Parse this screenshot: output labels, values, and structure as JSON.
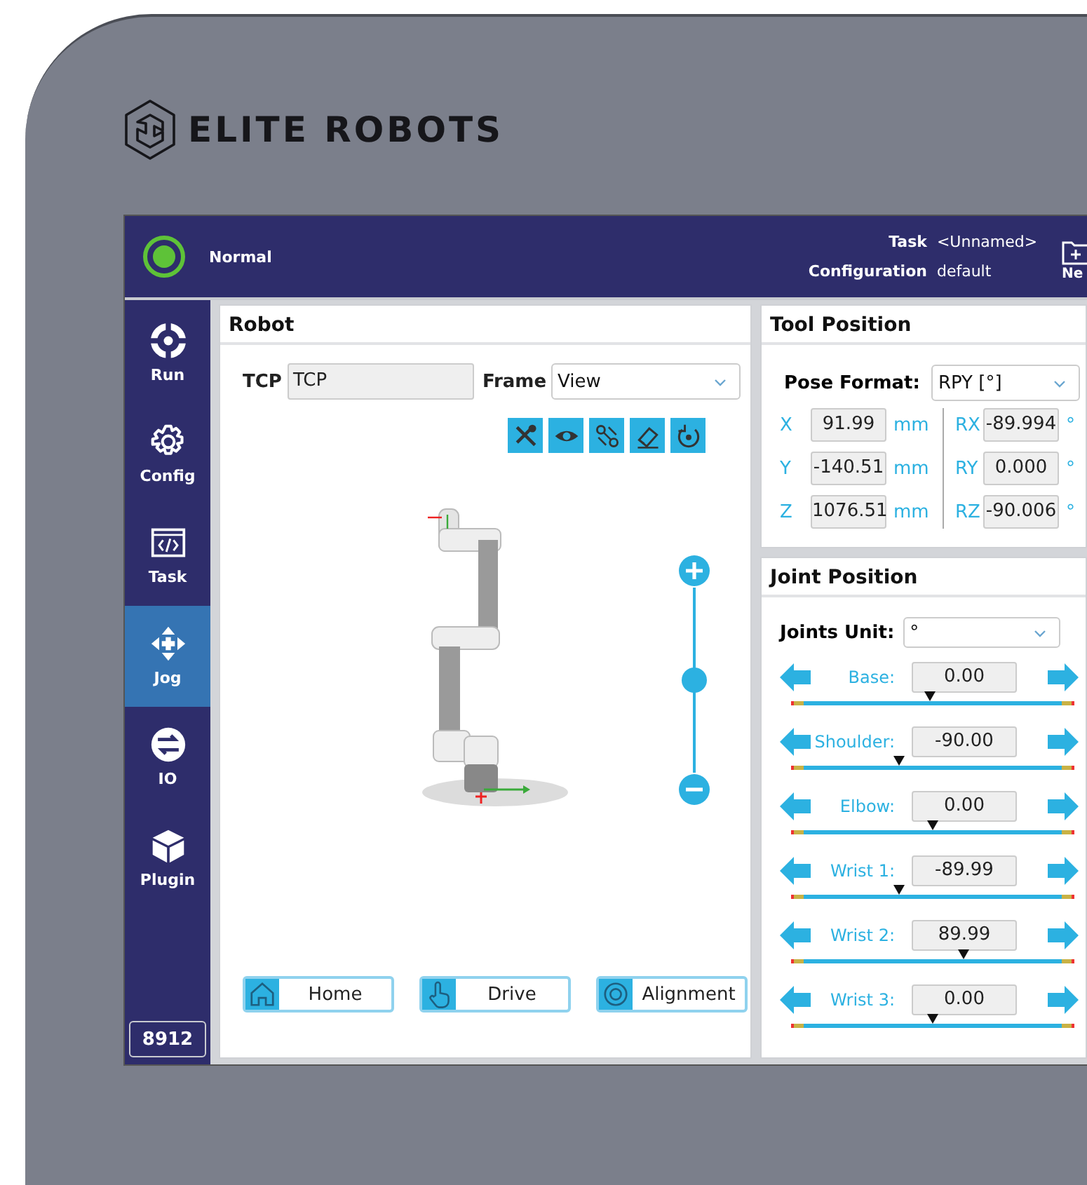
{
  "brand": {
    "name": "ELITE ROBOTS"
  },
  "header": {
    "status": {
      "label": "Normal",
      "color": "#5ec238"
    },
    "task_label": "Task",
    "task_value": "<Unnamed>",
    "configuration_label": "Configuration",
    "configuration_value": "default",
    "new_button": "Ne"
  },
  "sidebar": {
    "items": [
      {
        "label": "Run",
        "kind": "run",
        "selected": false
      },
      {
        "label": "Config",
        "kind": "config",
        "selected": false
      },
      {
        "label": "Task",
        "kind": "task",
        "selected": false
      },
      {
        "label": "Jog",
        "kind": "jog",
        "selected": true
      },
      {
        "label": "IO",
        "kind": "io",
        "selected": false
      },
      {
        "label": "Plugin",
        "kind": "plugin",
        "selected": false
      }
    ],
    "badge": "8912"
  },
  "robot_panel": {
    "title": "Robot",
    "tcp_label": "TCP",
    "tcp_value": "TCP",
    "frame_label": "Frame",
    "frame_value": "View",
    "tools": [
      {
        "kind": "tools"
      },
      {
        "kind": "eye"
      },
      {
        "kind": "path"
      },
      {
        "kind": "eraser"
      },
      {
        "kind": "rotate"
      }
    ],
    "zoom": {
      "level": 0.5
    },
    "buttons": [
      {
        "label": "Home",
        "kind": "home"
      },
      {
        "label": "Drive",
        "kind": "hand"
      },
      {
        "label": "Alignment",
        "kind": "target"
      }
    ]
  },
  "tool_position": {
    "title": "Tool Position",
    "format_label": "Pose Format:",
    "format_value": "RPY [°]",
    "rows": [
      {
        "axis": "X",
        "value": "91.99",
        "unit": "mm",
        "rot_axis": "RX",
        "rot_value": "-89.994",
        "rot_unit": "°"
      },
      {
        "axis": "Y",
        "value": "-140.51",
        "unit": "mm",
        "rot_axis": "RY",
        "rot_value": "0.000",
        "rot_unit": "°"
      },
      {
        "axis": "Z",
        "value": "1076.51",
        "unit": "mm",
        "rot_axis": "RZ",
        "rot_value": "-90.006",
        "rot_unit": "°"
      }
    ]
  },
  "joint_position": {
    "title": "Joint Position",
    "unit_label": "Joints Unit:",
    "unit_value": "°",
    "joints": [
      {
        "name": "Base:",
        "value": "0.00",
        "level": 0.49
      },
      {
        "name": "Shoulder:",
        "value": "-90.00",
        "level": 0.37
      },
      {
        "name": "Elbow:",
        "value": "0.00",
        "level": 0.5
      },
      {
        "name": "Wrist 1:",
        "value": "-89.99",
        "level": 0.37
      },
      {
        "name": "Wrist 2:",
        "value": "89.99",
        "level": 0.62
      },
      {
        "name": "Wrist 3:",
        "value": "0.00",
        "level": 0.5
      }
    ]
  }
}
